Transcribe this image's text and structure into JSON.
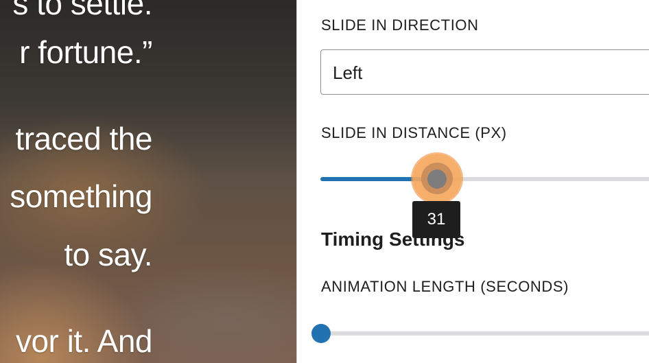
{
  "preview": {
    "lines": [
      "s to settle.",
      "r fortune.”",
      "traced the",
      "something",
      "to say.",
      "vor it. And"
    ]
  },
  "settings": {
    "slide_direction": {
      "label": "SLIDE IN DIRECTION",
      "value": "Left"
    },
    "slide_distance": {
      "label": "SLIDE IN DISTANCE (PX)",
      "value": "31"
    },
    "timing_heading": "Timing Settings",
    "animation_length": {
      "label": "ANIMATION LENGTH (SECONDS)"
    }
  },
  "colors": {
    "accent": "#2271b1",
    "focus_halo": "#f5a65a",
    "tooltip_bg": "#1e1e1e"
  }
}
